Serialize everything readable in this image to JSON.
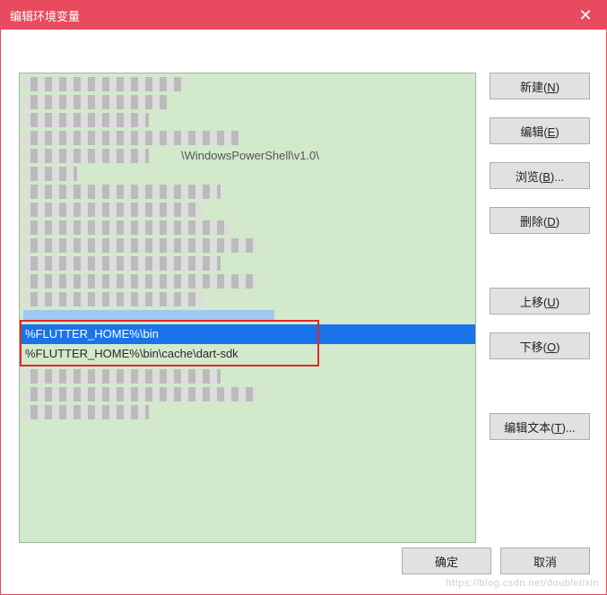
{
  "window": {
    "title": "编辑环境变量"
  },
  "list": {
    "visible_row_1": "%FLUTTER_HOME%\\bin",
    "visible_row_2": "%FLUTTER_HOME%\\bin\\cache\\dart-sdk",
    "partial_row_hint": "\\WindowsPowerShell\\v1.0\\"
  },
  "buttons": {
    "new_pre": "新建(",
    "new_u": "N",
    "new_post": ")",
    "edit_pre": "编辑(",
    "edit_u": "E",
    "edit_post": ")",
    "browse_pre": "浏览(",
    "browse_u": "B",
    "browse_post": ")...",
    "delete_pre": "删除(",
    "delete_u": "D",
    "delete_post": ")",
    "up_pre": "上移(",
    "up_u": "U",
    "up_post": ")",
    "down_pre": "下移(",
    "down_u": "O",
    "down_post": ")",
    "edittext_pre": "编辑文本(",
    "edittext_u": "T",
    "edittext_post": ")...",
    "ok": "确定",
    "cancel": "取消"
  },
  "watermark": "https://blog.csdn.net/doubletixin"
}
